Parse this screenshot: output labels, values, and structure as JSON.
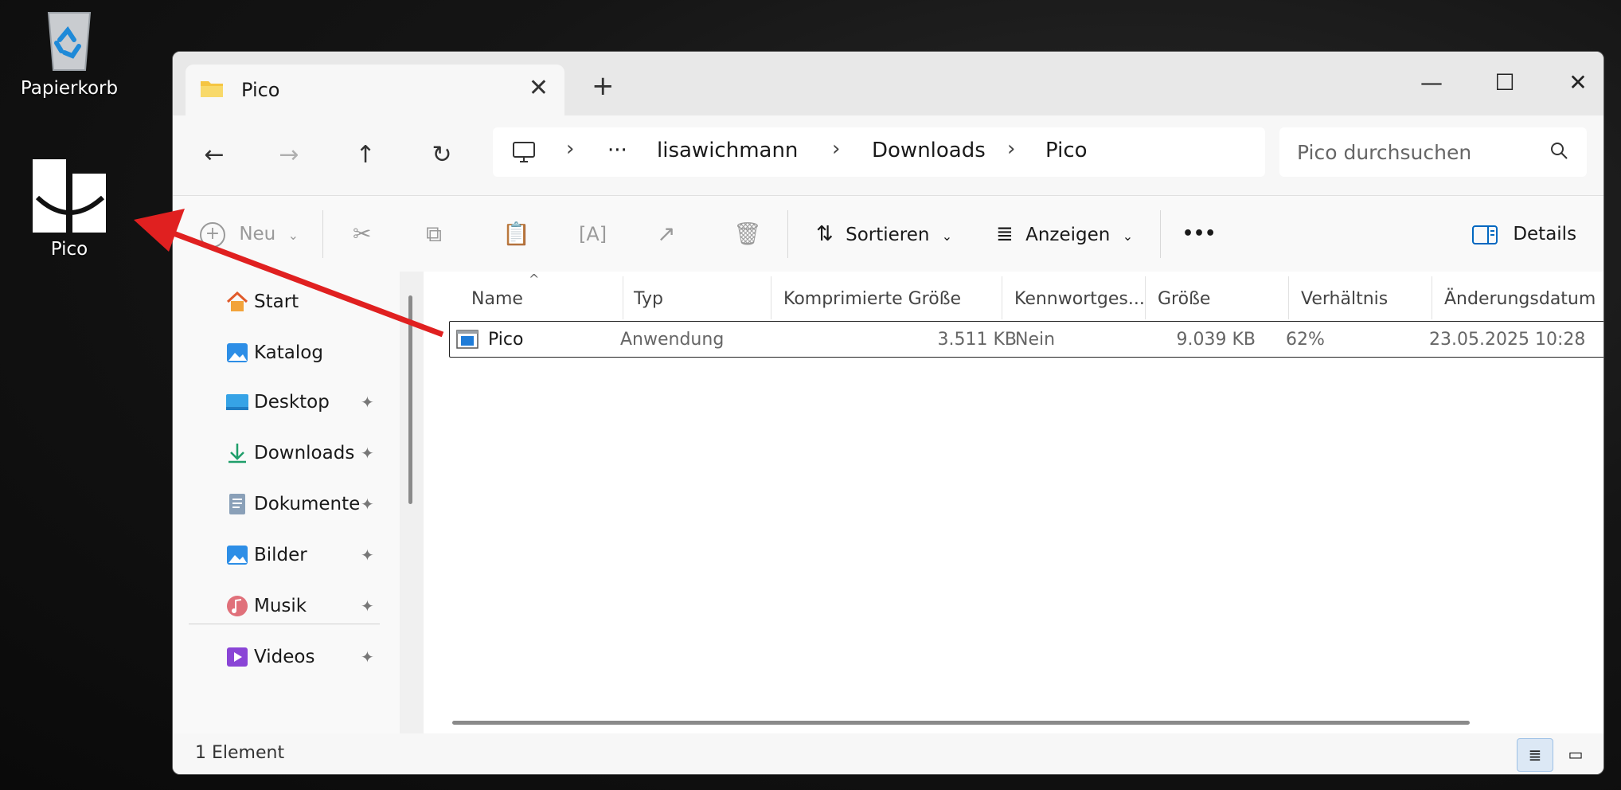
{
  "desktop": {
    "recycle_bin_label": "Papierkorb",
    "pico_label": "Pico"
  },
  "window": {
    "tab_title": "Pico",
    "minimize_symbol": "—",
    "maximize_symbol": "☐",
    "close_symbol": "✕"
  },
  "address": {
    "more": "···",
    "parts": [
      "lisawichmann",
      "Downloads",
      "Pico"
    ]
  },
  "search": {
    "placeholder": "Pico durchsuchen"
  },
  "toolbar": {
    "new_label": "Neu",
    "sort_label": "Sortieren",
    "view_label": "Anzeigen",
    "more_label": "•••",
    "details_label": "Details"
  },
  "sidebar": {
    "items": [
      {
        "label": "Start",
        "icon": "home-icon"
      },
      {
        "label": "Katalog",
        "icon": "gallery-icon"
      },
      {
        "label": "Desktop",
        "icon": "desktop-icon",
        "pinned": true
      },
      {
        "label": "Downloads",
        "icon": "downloads-icon",
        "pinned": true
      },
      {
        "label": "Dokumente",
        "icon": "documents-icon",
        "pinned": true
      },
      {
        "label": "Bilder",
        "icon": "pictures-icon",
        "pinned": true
      },
      {
        "label": "Musik",
        "icon": "music-icon",
        "pinned": true
      },
      {
        "label": "Videos",
        "icon": "videos-icon",
        "pinned": true
      }
    ]
  },
  "columns": [
    "Name",
    "Typ",
    "Komprimierte Größe",
    "Kennwortges...",
    "Größe",
    "Verhältnis",
    "Änderungsdatum"
  ],
  "files": [
    {
      "name": "Pico",
      "type": "Anwendung",
      "compressed": "3.511 KB",
      "password": "Nein",
      "size": "9.039 KB",
      "ratio": "62%",
      "modified": "23.05.2025 10:28"
    }
  ],
  "status": {
    "count": "1 Element"
  },
  "colors": {
    "accent": "#0067c0",
    "arrow": "#e02020"
  }
}
